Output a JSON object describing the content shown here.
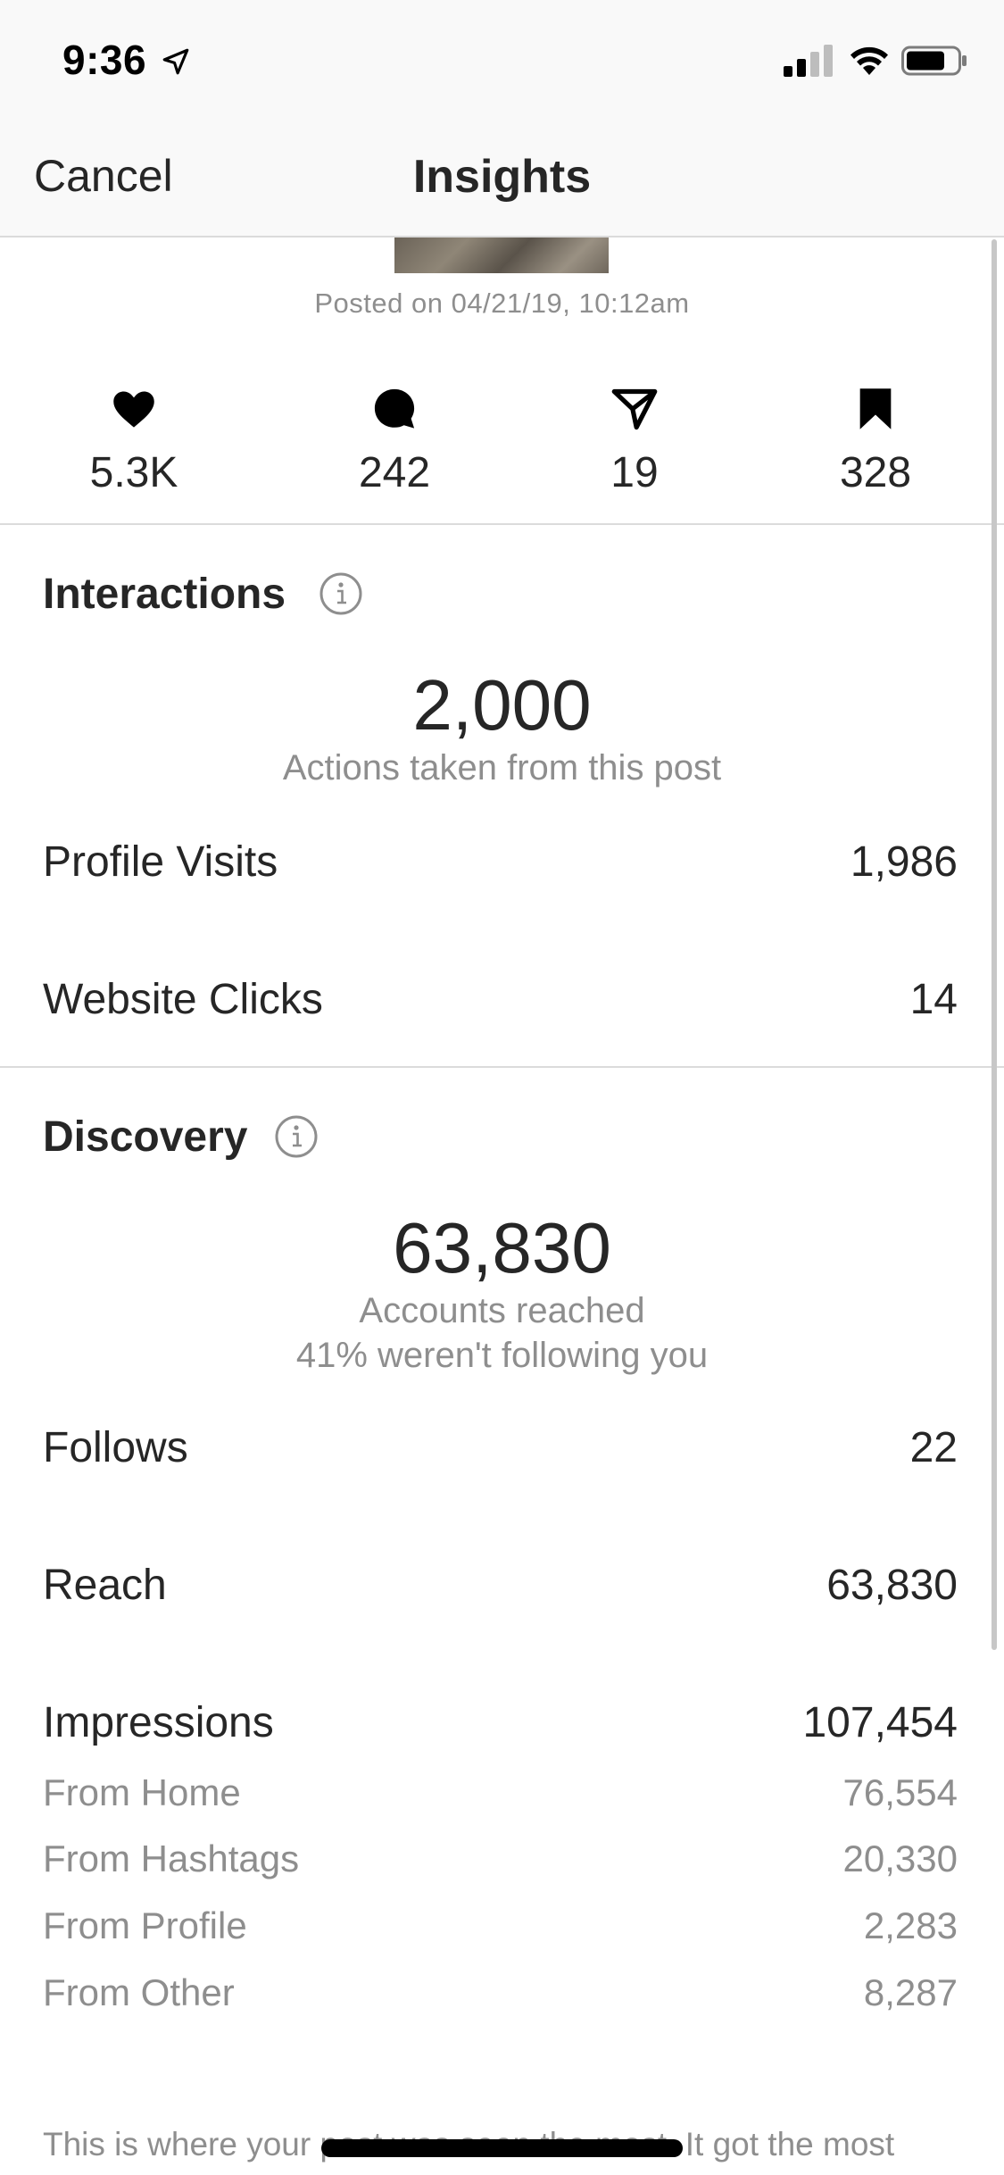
{
  "status_bar": {
    "time": "9:36"
  },
  "nav": {
    "cancel_label": "Cancel",
    "title": "Insights"
  },
  "post": {
    "posted_on": "Posted on 04/21/19, 10:12am"
  },
  "stats": [
    {
      "icon": "heart-icon",
      "value": "5.3K"
    },
    {
      "icon": "comment-icon",
      "value": "242"
    },
    {
      "icon": "share-icon",
      "value": "19"
    },
    {
      "icon": "bookmark-icon",
      "value": "328"
    }
  ],
  "interactions": {
    "title": "Interactions",
    "total": "2,000",
    "total_caption": "Actions taken from this post",
    "rows": [
      {
        "label": "Profile Visits",
        "value": "1,986"
      },
      {
        "label": "Website Clicks",
        "value": "14"
      }
    ]
  },
  "discovery": {
    "title": "Discovery",
    "total": "63,830",
    "caption_1": "Accounts reached",
    "caption_2": "41% weren't following you",
    "rows": [
      {
        "label": "Follows",
        "value": "22"
      },
      {
        "label": "Reach",
        "value": "63,830"
      },
      {
        "label": "Impressions",
        "value": "107,454"
      }
    ],
    "impression_sources": [
      {
        "label": "From Home",
        "value": "76,554"
      },
      {
        "label": "From Hashtags",
        "value": "20,330"
      },
      {
        "label": "From Profile",
        "value": "2,283"
      },
      {
        "label": "From Other",
        "value": "8,287"
      }
    ]
  },
  "footer": {
    "text": "This is where your post was seen the most. It got the most"
  },
  "colors": {
    "text": "#262626",
    "secondary": "#8e8e8e",
    "divider": "#dbdbdb",
    "bar_bg": "#f9f9f9"
  }
}
